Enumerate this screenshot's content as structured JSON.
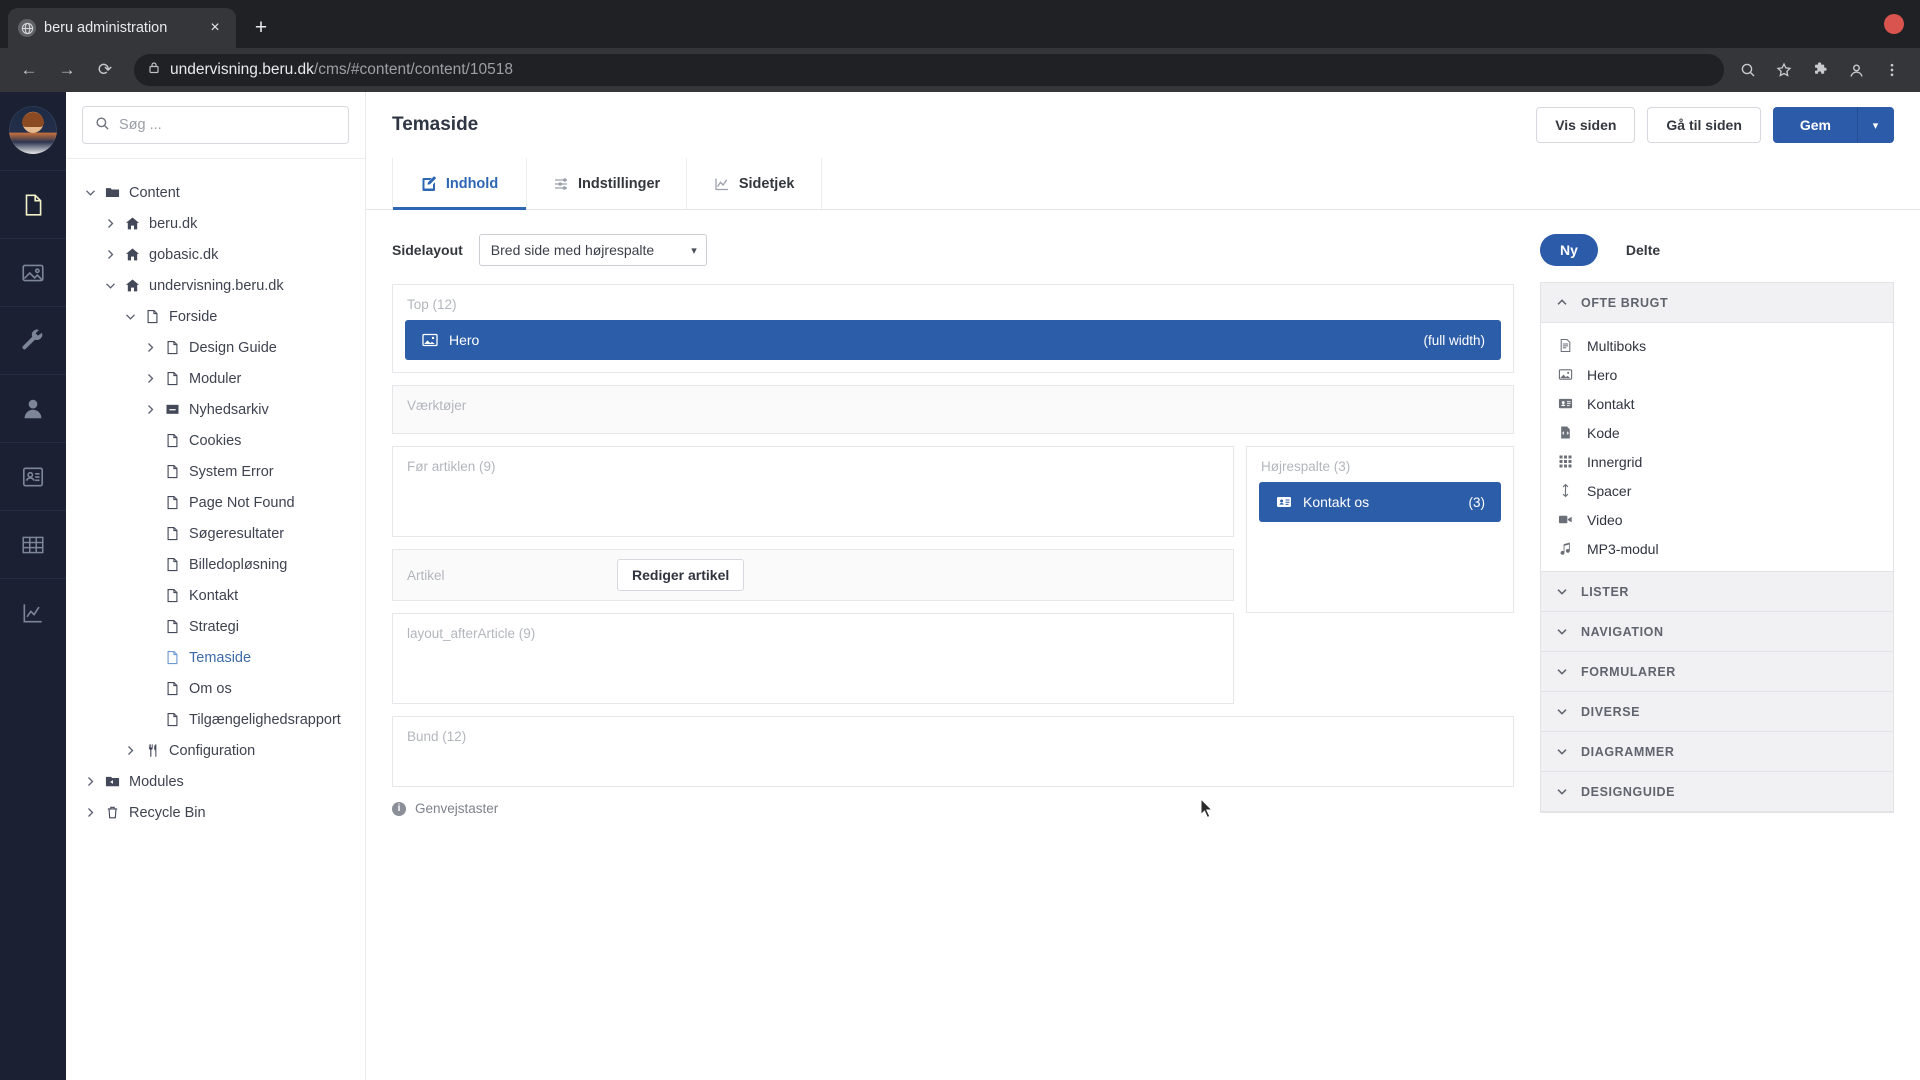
{
  "browser": {
    "tab_title": "beru administration",
    "tab_favicon": "globe-icon",
    "new_tab_label": "+",
    "close_label": "×",
    "back_label": "←",
    "forward_label": "→",
    "reload_label": "⟳",
    "url_domain": "undervisning.beru.dk",
    "url_path": "/cms/#content/content/10518",
    "lock_icon": "lock-icon"
  },
  "rail": {
    "avatar": "user-avatar",
    "items": [
      {
        "name": "content-icon",
        "active": true
      },
      {
        "name": "media-icon",
        "active": false
      },
      {
        "name": "settings-wrench-icon",
        "active": false
      },
      {
        "name": "users-icon",
        "active": false
      },
      {
        "name": "members-icon",
        "active": false
      },
      {
        "name": "forms-table-icon",
        "active": false
      },
      {
        "name": "analytics-chart-icon",
        "active": false
      }
    ]
  },
  "sidebar": {
    "search_placeholder": "Søg ...",
    "tree": [
      {
        "label": "Content",
        "depth": 0,
        "caret": "down",
        "icon": "folder-icon",
        "selected": false
      },
      {
        "label": "beru.dk",
        "depth": 1,
        "caret": "right",
        "icon": "home-icon",
        "selected": false
      },
      {
        "label": "gobasic.dk",
        "depth": 1,
        "caret": "right",
        "icon": "home-icon",
        "selected": false
      },
      {
        "label": "undervisning.beru.dk",
        "depth": 1,
        "caret": "down",
        "icon": "home-icon",
        "selected": false
      },
      {
        "label": "Forside",
        "depth": 2,
        "caret": "down",
        "icon": "document-icon",
        "selected": false
      },
      {
        "label": "Design Guide",
        "depth": 3,
        "caret": "right",
        "icon": "document-icon",
        "selected": false
      },
      {
        "label": "Moduler",
        "depth": 3,
        "caret": "right",
        "icon": "document-icon",
        "selected": false
      },
      {
        "label": "Nyhedsarkiv",
        "depth": 3,
        "caret": "right",
        "icon": "archive-icon",
        "selected": false
      },
      {
        "label": "Cookies",
        "depth": 3,
        "caret": "none",
        "icon": "document-icon",
        "selected": false
      },
      {
        "label": "System Error",
        "depth": 3,
        "caret": "none",
        "icon": "document-icon",
        "selected": false
      },
      {
        "label": "Page Not Found",
        "depth": 3,
        "caret": "none",
        "icon": "document-icon",
        "selected": false
      },
      {
        "label": "Søgeresultater",
        "depth": 3,
        "caret": "none",
        "icon": "document-icon",
        "selected": false
      },
      {
        "label": "Billedopløsning",
        "depth": 3,
        "caret": "none",
        "icon": "document-icon",
        "selected": false
      },
      {
        "label": "Kontakt",
        "depth": 3,
        "caret": "none",
        "icon": "document-icon",
        "selected": false
      },
      {
        "label": "Strategi",
        "depth": 3,
        "caret": "none",
        "icon": "document-icon",
        "selected": false
      },
      {
        "label": "Temaside",
        "depth": 3,
        "caret": "none",
        "icon": "document-icon",
        "selected": true
      },
      {
        "label": "Om os",
        "depth": 3,
        "caret": "none",
        "icon": "document-icon",
        "selected": false
      },
      {
        "label": "Tilgængelighedsrapport",
        "depth": 3,
        "caret": "none",
        "icon": "document-icon",
        "selected": false
      },
      {
        "label": "Configuration",
        "depth": 2,
        "caret": "right",
        "icon": "config-icon",
        "selected": false
      },
      {
        "label": "Modules",
        "depth": 0,
        "caret": "right",
        "icon": "modules-icon",
        "selected": false
      },
      {
        "label": "Recycle Bin",
        "depth": 0,
        "caret": "right",
        "icon": "trash-icon",
        "selected": false
      }
    ]
  },
  "editor": {
    "title": "Temaside",
    "actions": {
      "preview_label": "Vis siden",
      "goto_label": "Gå til siden",
      "save_label": "Gem",
      "save_caret": "▾"
    },
    "tabs": [
      {
        "label": "Indhold",
        "icon": "edit-content-icon",
        "active": true
      },
      {
        "label": "Indstillinger",
        "icon": "sliders-icon",
        "active": false
      },
      {
        "label": "Sidetjek",
        "icon": "chart-icon",
        "active": false
      }
    ],
    "layout": {
      "label": "Sidelayout",
      "selected": "Bred side med højrespalte",
      "caret": "▾"
    },
    "grid": {
      "top": {
        "label": "Top (12)",
        "modules": [
          {
            "name": "Hero",
            "icon": "image-icon",
            "meta": "(full width)"
          }
        ]
      },
      "vaerktojer": {
        "label": "Værktøjer",
        "modules": []
      },
      "for_artiklen": {
        "label": "Før artiklen (9)",
        "modules": []
      },
      "artikel": {
        "label": "Artikel",
        "edit_label": "Rediger artikel"
      },
      "after_article": {
        "label": "layout_afterArticle (9)",
        "modules": []
      },
      "hojrespalte": {
        "label": "Højrespalte (3)",
        "modules": [
          {
            "name": "Kontakt os",
            "icon": "contact-card-icon",
            "meta": "(3)"
          }
        ]
      },
      "bund": {
        "label": "Bund (12)",
        "modules": []
      }
    },
    "shortcuts_label": "Genvejstaster",
    "shortcuts_icon": "info-icon"
  },
  "side_panel": {
    "pills": [
      {
        "label": "Ny",
        "active": true
      },
      {
        "label": "Delte",
        "active": false
      }
    ],
    "sections": [
      {
        "title": "OFTE BRUGT",
        "expanded": true,
        "caret": "up",
        "items": [
          {
            "label": "Multiboks",
            "icon": "multibox-icon"
          },
          {
            "label": "Hero",
            "icon": "image-icon"
          },
          {
            "label": "Kontakt",
            "icon": "contact-card-icon"
          },
          {
            "label": "Kode",
            "icon": "code-file-icon"
          },
          {
            "label": "Innergrid",
            "icon": "grid-icon"
          },
          {
            "label": "Spacer",
            "icon": "vertical-arrows-icon"
          },
          {
            "label": "Video",
            "icon": "video-icon"
          },
          {
            "label": "MP3-modul",
            "icon": "music-note-icon"
          }
        ]
      },
      {
        "title": "LISTER",
        "expanded": false,
        "caret": "down",
        "items": []
      },
      {
        "title": "NAVIGATION",
        "expanded": false,
        "caret": "down",
        "items": []
      },
      {
        "title": "FORMULARER",
        "expanded": false,
        "caret": "down",
        "items": []
      },
      {
        "title": "DIVERSE",
        "expanded": false,
        "caret": "down",
        "items": []
      },
      {
        "title": "DIAGRAMMER",
        "expanded": false,
        "caret": "down",
        "items": []
      },
      {
        "title": "DESIGNGUIDE",
        "expanded": false,
        "caret": "down",
        "items": []
      }
    ]
  },
  "colors": {
    "accent": "#2b5ba9",
    "module": "#2c5da8",
    "rail_bg": "#1b2133",
    "chrome_bg": "#202124",
    "selected_tree": "#3d6ba8"
  }
}
